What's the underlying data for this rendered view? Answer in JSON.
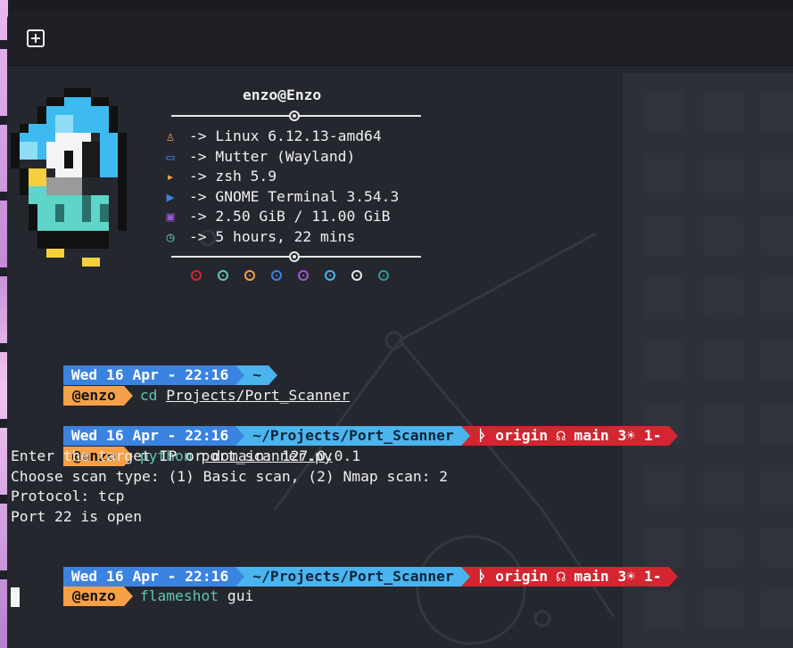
{
  "titlebar": {
    "new_tab_icon": "new-tab-plus-icon"
  },
  "fetch": {
    "header": "enzo@Enzo",
    "items": [
      {
        "icon": "distro-icon",
        "color": "#f6a048",
        "text": "-> Linux 6.12.13-amd64"
      },
      {
        "icon": "window-manager-icon",
        "color": "#3b83e0",
        "text": "-> Mutter (Wayland)"
      },
      {
        "icon": "shell-icon",
        "color": "#f6a048",
        "text": "-> zsh 5.9"
      },
      {
        "icon": "terminal-icon",
        "color": "#3b83e0",
        "text": "-> GNOME Terminal 3.54.3"
      },
      {
        "icon": "memory-icon",
        "color": "#9b59d0",
        "text": "-> 2.50 GiB / 11.00 GiB"
      },
      {
        "icon": "uptime-icon",
        "color": "#5fc6b0",
        "text": "-> 5 hours, 22 mins"
      }
    ],
    "palette": [
      "#d42531",
      "#5fc6b0",
      "#f6a048",
      "#3b83e0",
      "#9b59d0",
      "#4ab4ee",
      "#e8e8e8",
      "#2a9d8f"
    ]
  },
  "prompts": [
    {
      "date": "Wed 16 Apr - 22:16",
      "dir": "~",
      "user": "@enzo",
      "cmd": "cd",
      "arg": "Projects/Port_Scanner"
    },
    {
      "date": "Wed 16 Apr - 22:16",
      "dir": "~/Projects/Port_Scanner",
      "git": "ᚦ origin ☊ main 3☀ 1-",
      "user": "@enzo",
      "cmd": "python",
      "arg": "port_scanner.py"
    },
    {
      "date": "Wed 16 Apr - 22:16",
      "dir": "~/Projects/Port_Scanner",
      "git": "ᚦ origin ☊ main 3☀ 1-",
      "user": "@enzo",
      "cmd": "flameshot",
      "arg": "gui"
    }
  ],
  "output": [
    "Enter the target IP or domain: 127.0.0.1",
    "Choose scan type: (1) Basic scan, (2) Nmap scan: 2",
    "Protocol: tcp",
    "Port 22 is open"
  ]
}
